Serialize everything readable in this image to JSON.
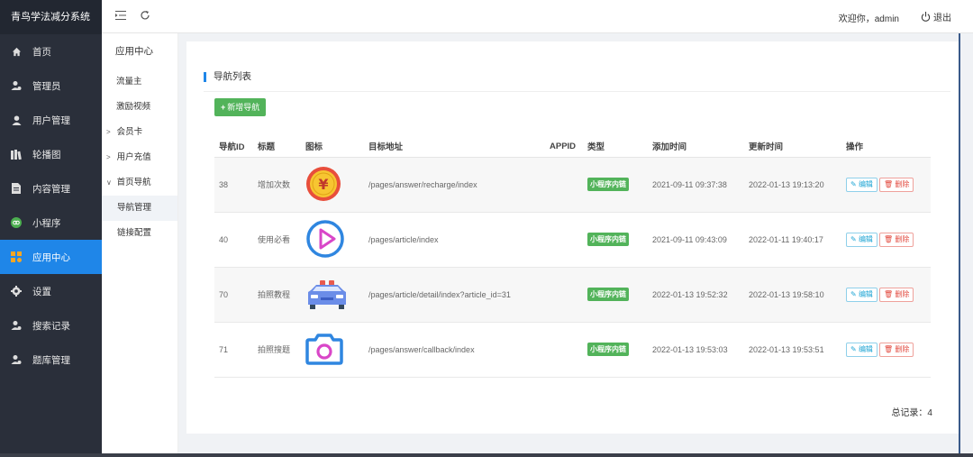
{
  "app": {
    "title": "青鸟学法减分系统"
  },
  "sidebar": {
    "items": [
      {
        "label": "首页",
        "icon": "home-icon"
      },
      {
        "label": "管理员",
        "icon": "user-gear-icon"
      },
      {
        "label": "用户管理",
        "icon": "user-icon"
      },
      {
        "label": "轮播图",
        "icon": "images-icon"
      },
      {
        "label": "内容管理",
        "icon": "document-icon"
      },
      {
        "label": "小程序",
        "icon": "wechat-icon"
      },
      {
        "label": "应用中心",
        "icon": "apps-icon",
        "active": true
      },
      {
        "label": "设置",
        "icon": "gear-icon"
      },
      {
        "label": "搜索记录",
        "icon": "user-gear-icon"
      },
      {
        "label": "题库管理",
        "icon": "user-gear-icon"
      }
    ]
  },
  "header": {
    "welcome": "欢迎你，admin",
    "logout": "退出",
    "menu_toggle_icon": "menu-collapse-icon",
    "refresh_icon": "refresh-icon"
  },
  "submenu": {
    "title": "应用中心",
    "items": [
      {
        "label": "流量主"
      },
      {
        "label": "激励视频"
      },
      {
        "label": "会员卡",
        "caret": ">"
      },
      {
        "label": "用户充值",
        "caret": ">"
      },
      {
        "label": "首页导航",
        "caret": "∨"
      },
      {
        "label": "导航管理",
        "active": true
      },
      {
        "label": "链接配置"
      }
    ]
  },
  "main": {
    "title": "导航列表",
    "add_button": "新增导航",
    "columns": [
      "导航ID",
      "标题",
      "图标",
      "目标地址",
      "APPID",
      "类型",
      "添加时间",
      "更新时间",
      "操作"
    ],
    "rows": [
      {
        "id": "38",
        "title": "增加次数",
        "icon": "yuan-coin-icon",
        "url": "/pages/answer/recharge/index",
        "appid": "",
        "type": "小程序内链",
        "added": "2021-09-11 09:37:38",
        "updated": "2022-01-13 19:13:20"
      },
      {
        "id": "40",
        "title": "使用必看",
        "icon": "play-circle-icon",
        "url": "/pages/article/index",
        "appid": "",
        "type": "小程序内链",
        "added": "2021-09-11 09:43:09",
        "updated": "2022-01-11 19:40:17"
      },
      {
        "id": "70",
        "title": "拍照教程",
        "icon": "car-icon",
        "url": "/pages/article/detail/index?article_id=31",
        "appid": "",
        "type": "小程序内链",
        "added": "2022-01-13 19:52:32",
        "updated": "2022-01-13 19:58:10"
      },
      {
        "id": "71",
        "title": "拍照搜题",
        "icon": "camera-icon",
        "url": "/pages/answer/callback/index",
        "appid": "",
        "type": "小程序内链",
        "added": "2022-01-13 19:53:03",
        "updated": "2022-01-13 19:53:51"
      }
    ],
    "edit_label": "编辑",
    "delete_label": "删除",
    "total": "总记录：4"
  },
  "colors": {
    "accent": "#1f86e8",
    "success": "#52b35a",
    "sidebar_bg": "#2a2f3a",
    "danger": "#e2483d"
  }
}
